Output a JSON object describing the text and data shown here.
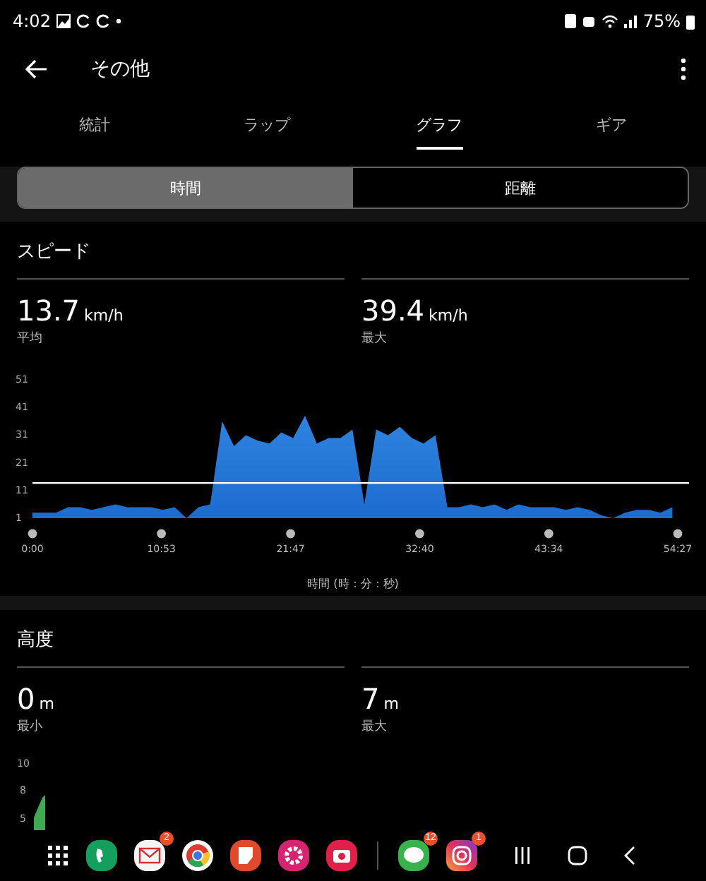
{
  "status_bar": {
    "time": "4:02",
    "battery": "75%"
  },
  "app_bar": {
    "title": "その他"
  },
  "tabs": [
    {
      "label": "統計",
      "selected": false
    },
    {
      "label": "ラップ",
      "selected": false
    },
    {
      "label": "グラフ",
      "selected": true
    },
    {
      "label": "ギア",
      "selected": false
    }
  ],
  "segments": [
    {
      "label": "時間",
      "selected": true
    },
    {
      "label": "距離",
      "selected": false
    }
  ],
  "sections": [
    {
      "title": "スピード",
      "stats": [
        {
          "value": "13.7",
          "unit": "km/h",
          "label": "平均"
        },
        {
          "value": "39.4",
          "unit": "km/h",
          "label": "最大"
        }
      ],
      "chart_data": {
        "type": "area",
        "xlabel": "時間 (時：分：秒)",
        "x": [
          0,
          1,
          2,
          3,
          4,
          5,
          6,
          7,
          8,
          9,
          10,
          11,
          12,
          13,
          14,
          15,
          16,
          17,
          18,
          19,
          20,
          21,
          22,
          23,
          24,
          25,
          26,
          27,
          28,
          29,
          30,
          31,
          32,
          33,
          34,
          35,
          36,
          37,
          38,
          39,
          40,
          41,
          42,
          43,
          44,
          45,
          46,
          47,
          48,
          49,
          50,
          51,
          52,
          53,
          54
        ],
        "series": [
          {
            "color": "#2f83e0",
            "values": [
              3,
              3,
              3,
              5,
              5,
              4,
              5,
              6,
              5,
              5,
              5,
              4,
              5,
              1,
              5,
              6,
              36,
              27,
              31,
              29,
              28,
              32,
              30,
              38,
              28,
              30,
              30,
              33,
              6,
              33,
              31,
              34,
              30,
              28,
              31,
              5,
              5,
              6,
              5,
              6,
              4,
              6,
              5,
              5,
              5,
              4,
              5,
              4,
              2,
              1,
              3,
              4,
              4,
              3,
              5
            ]
          }
        ],
        "xlim": [
          0,
          54.45
        ],
        "ylim": [
          1,
          51
        ],
        "xticks": [
          {
            "value": 0,
            "label": "0:00"
          },
          {
            "value": 10.88,
            "label": "10:53"
          },
          {
            "value": 21.78,
            "label": "21:47"
          },
          {
            "value": 32.67,
            "label": "32:40"
          },
          {
            "value": 43.57,
            "label": "43:34"
          },
          {
            "value": 54.45,
            "label": "54:27"
          }
        ],
        "yticks": [
          1,
          11,
          21,
          31,
          41,
          51
        ],
        "ref_lines": [
          {
            "axis": "y",
            "value": 13.7
          }
        ]
      }
    },
    {
      "title": "高度",
      "stats": [
        {
          "value": "0",
          "unit": "m",
          "label": "最小"
        },
        {
          "value": "7",
          "unit": "m",
          "label": "最大"
        }
      ],
      "tick_labels": [
        "10",
        "8",
        "5"
      ]
    }
  ],
  "dock": [
    {
      "kind": "apps"
    },
    {
      "kind": "phone"
    },
    {
      "kind": "mail",
      "badge": "2"
    },
    {
      "kind": "browser"
    },
    {
      "kind": "notes"
    },
    {
      "kind": "flower"
    },
    {
      "kind": "camera"
    },
    {
      "kind": "divider"
    },
    {
      "kind": "chat",
      "badge": "12"
    },
    {
      "kind": "photo",
      "badge": "1"
    }
  ]
}
